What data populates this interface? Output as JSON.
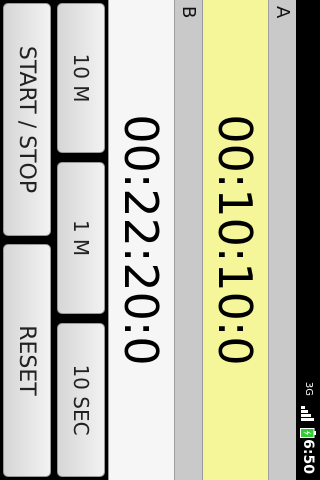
{
  "status": {
    "time": "6:50",
    "network": "3G"
  },
  "timers": [
    {
      "label": "A",
      "value": "00:10:10:0",
      "color": "#f5f59a"
    },
    {
      "label": "B",
      "value": "00:22:20:0",
      "color": "#f6f6f6"
    }
  ],
  "buttons": {
    "start_stop": "START / STOP",
    "reset": "RESET",
    "ten_min": "10 M",
    "one_min": "1 M",
    "ten_sec": "10 SEC"
  },
  "icons": [
    "signal-icon",
    "battery-icon"
  ],
  "colors": {
    "timer_a_bg": "#f5f59a",
    "timer_b_bg": "#f6f6f6",
    "background": "#000000"
  }
}
